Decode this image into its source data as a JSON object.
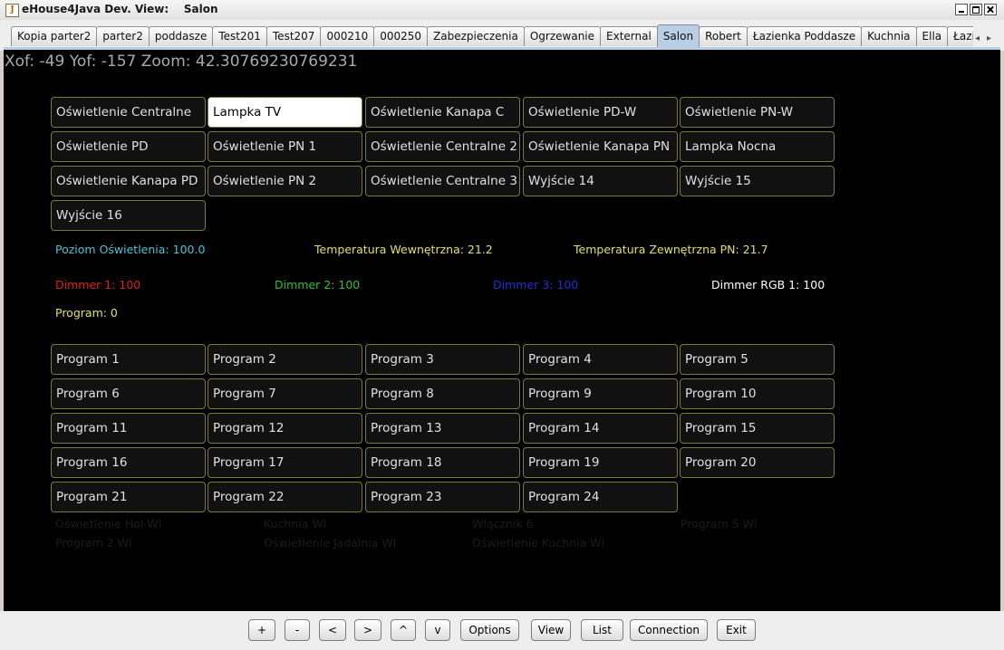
{
  "window": {
    "title": "eHouse4Java Dev. View:    Salon"
  },
  "tabs": [
    "Kopia parter2",
    "parter2",
    "poddasze",
    "Test201",
    "Test207",
    "000210",
    "000250",
    "Zabezpieczenia",
    "Ogrzewanie",
    "External",
    "Salon",
    "Robert",
    "Łazienka Poddasze",
    "Kuchnia",
    "Ella",
    "Łazie"
  ],
  "active_tab": "Salon",
  "status": {
    "text": "Xof: -49 Yof: -157 Zoom: 42.30769230769231"
  },
  "outputs": [
    "Oświetlenie Centralne",
    "Lampka TV",
    "Oświetlenie Kanapa C",
    "Oświetlenie PD-W",
    "Oświetlenie PN-W",
    "Oświetlenie PD",
    "Oświetlenie PN 1",
    "Oświetlenie Centralne 2",
    "Oświetlenie Kanapa PN",
    "Lampka Nocna",
    "Oświetlenie Kanapa PD",
    "Oświetlenie PN 2",
    "Oświetlenie Centralne 3",
    "Wyjście 14",
    "Wyjście 15",
    "Wyjście 16"
  ],
  "active_output": "Lampka TV",
  "readings": {
    "light_level": "Poziom Oświetlenia: 100.0",
    "temp_inside": "Temperatura Wewnętrzna: 21.2",
    "temp_outside": "Temperatura Zewnętrzna PN: 21.7",
    "dimmer1": "Dimmer 1: 100",
    "dimmer2": "Dimmer 2: 100",
    "dimmer3": "Dimmer 3: 100",
    "dimmer_rgb": "Dimmer RGB 1: 100",
    "program": "Program: 0"
  },
  "programs": [
    "Program 1",
    "Program 2",
    "Program 3",
    "Program 4",
    "Program 5",
    "Program 6",
    "Program 7",
    "Program 8",
    "Program 9",
    "Program 10",
    "Program 11",
    "Program 12",
    "Program 13",
    "Program 14",
    "Program 15",
    "Program 16",
    "Program 17",
    "Program 18",
    "Program 19",
    "Program 20",
    "Program 21",
    "Program 22",
    "Program 23",
    "Program 24"
  ],
  "faint_links": [
    "Oświetlenie Hol Wl",
    "Kuchnia Wl",
    "Włącznik 6",
    "Program 5 Wl",
    "Program 2 Wl",
    "Oświetlenie Jadalnia Wl",
    "Oświetlenie Kuchnia Wl"
  ],
  "bottom_buttons": [
    "+",
    "-",
    "<",
    ">",
    "^",
    "v",
    "Options",
    "View",
    "List",
    "Connection",
    "Exit"
  ],
  "colors": {
    "light_level": "#4fc3d8",
    "temps": "#e0e06a",
    "dimmer1": "#e02020",
    "dimmer2": "#30c030",
    "dimmer3": "#2030d0",
    "dimmer_rgb": "#ffffff",
    "program": "#e0e06a",
    "faint": "#1c1c1c"
  }
}
